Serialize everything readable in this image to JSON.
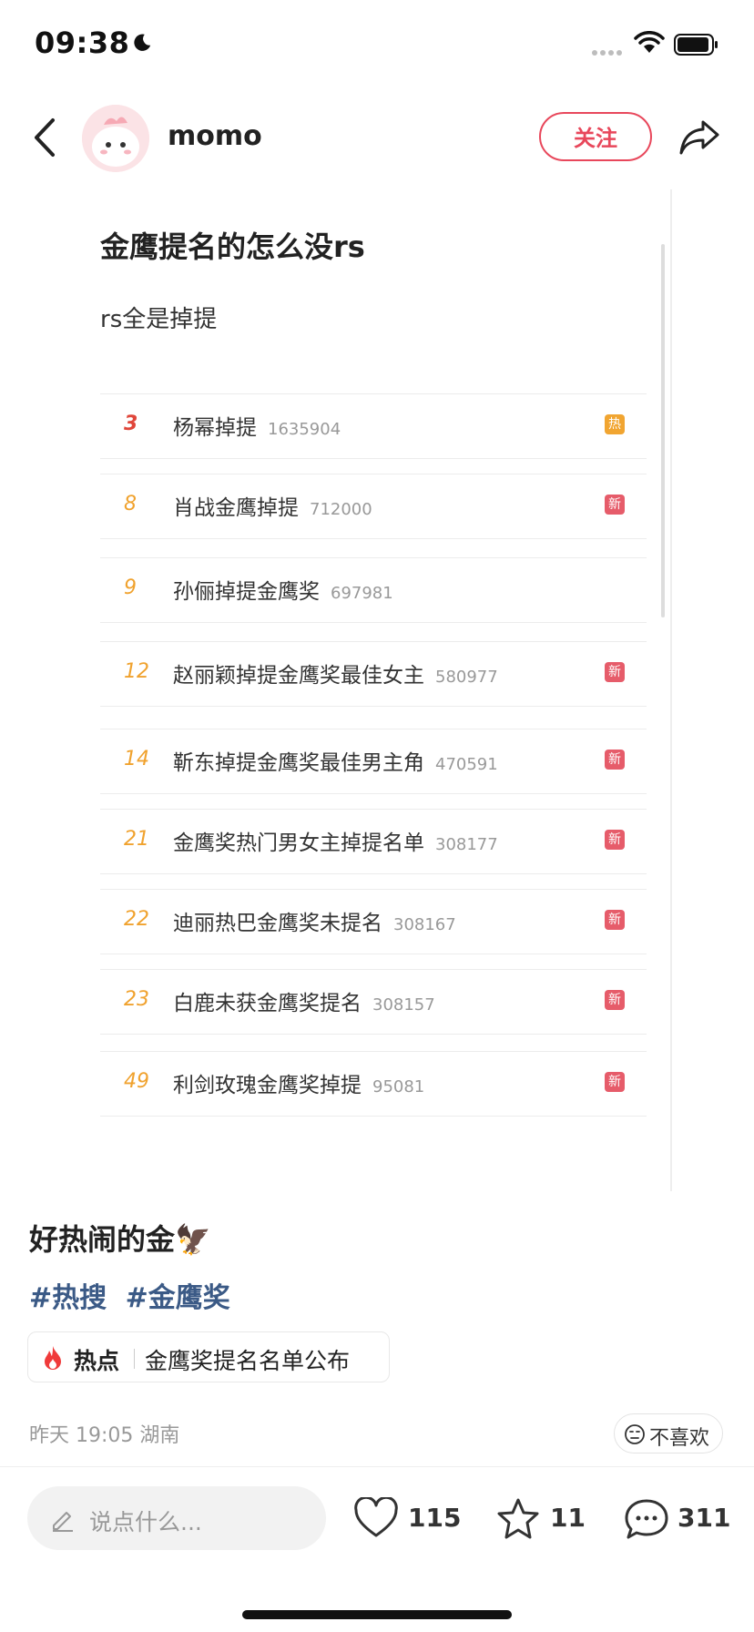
{
  "status_bar": {
    "time": "09:38"
  },
  "header": {
    "username": "momo",
    "follow_label": "关注"
  },
  "post_image": {
    "title": "金鹰提名的怎么没rs",
    "subtitle": "rs全是掉提",
    "rows": [
      {
        "rank": "3",
        "title": "杨幂掉提",
        "count": "1635904",
        "badge": "热",
        "badge_type": "hot"
      },
      {
        "rank": "8",
        "title": "肖战金鹰掉提",
        "count": "712000",
        "badge": "新",
        "badge_type": "new"
      },
      {
        "rank": "9",
        "title": "孙俪掉提金鹰奖",
        "count": "697981",
        "badge": "",
        "badge_type": "none"
      },
      {
        "rank": "12",
        "title": "赵丽颖掉提金鹰奖最佳女主",
        "count": "580977",
        "badge": "新",
        "badge_type": "new"
      },
      {
        "rank": "14",
        "title": "靳东掉提金鹰奖最佳男主角",
        "count": "470591",
        "badge": "新",
        "badge_type": "new"
      },
      {
        "rank": "21",
        "title": "金鹰奖热门男女主掉提名单",
        "count": "308177",
        "badge": "新",
        "badge_type": "new"
      },
      {
        "rank": "22",
        "title": "迪丽热巴金鹰奖未提名",
        "count": "308167",
        "badge": "新",
        "badge_type": "new"
      },
      {
        "rank": "23",
        "title": "白鹿未获金鹰奖提名",
        "count": "308157",
        "badge": "新",
        "badge_type": "new"
      },
      {
        "rank": "49",
        "title": "利剑玫瑰金鹰奖掉提",
        "count": "95081",
        "badge": "新",
        "badge_type": "new"
      }
    ]
  },
  "post": {
    "caption": "好热闹的金🦅",
    "tags": [
      "#热搜",
      "#金鹰奖"
    ],
    "hot_chip": {
      "label": "热点",
      "topic": "金鹰奖提名名单公布"
    },
    "meta": "昨天 19:05 湖南",
    "dislike_label": "不喜欢"
  },
  "bottom_bar": {
    "comment_placeholder": "说点什么...",
    "likes": "115",
    "stars": "11",
    "comments": "311"
  },
  "colors": {
    "accent_red": "#e8475b",
    "tag_blue": "#3b5a86",
    "rank_orange": "#f0a22e",
    "badge_hot": "#f1a531",
    "badge_new": "#e65c6a"
  }
}
